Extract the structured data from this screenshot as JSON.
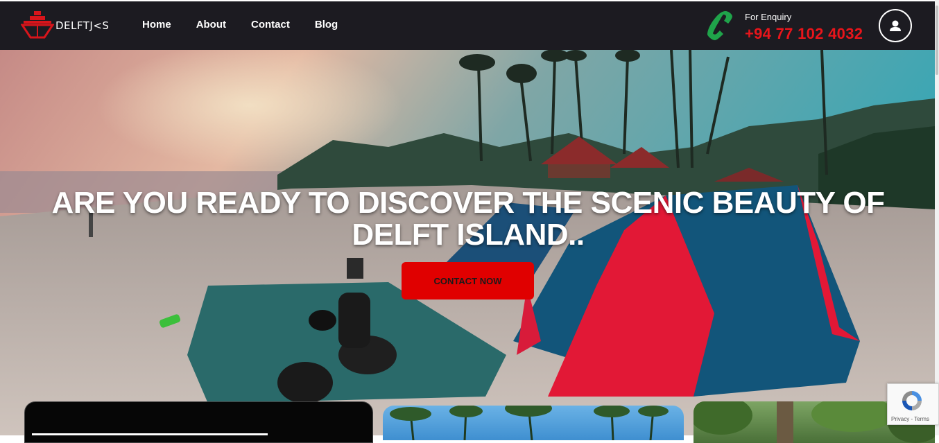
{
  "header": {
    "logo_text": "DELFTJ<S",
    "nav": [
      {
        "label": "Home"
      },
      {
        "label": "About"
      },
      {
        "label": "Contact"
      },
      {
        "label": "Blog"
      }
    ],
    "enquiry_label": "For Enquiry",
    "phone": "+94 77 102 4032",
    "icons": [
      "ship-logo-icon",
      "phone-icon",
      "user-icon"
    ]
  },
  "hero": {
    "title": "ARE YOU READY TO DISCOVER THE SCENIC BEAUTY OF DELFT ISLAND..",
    "cta_label": "CONTACT NOW"
  },
  "recaptcha": {
    "text": "Privacy - Terms"
  },
  "colors": {
    "navbar_bg": "#1c1b21",
    "accent_red": "#e00000",
    "phone_green": "#1fa34a",
    "phone_text": "#e8151b"
  }
}
